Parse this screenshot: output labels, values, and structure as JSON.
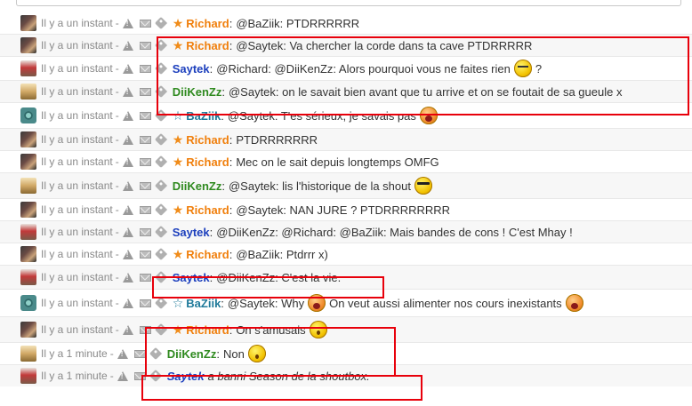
{
  "messages": [
    {
      "time": "Il y a un instant",
      "user": "Richard",
      "role": "orange",
      "avatar": "richard",
      "text": "@BaZiik: PTDRRRRRR"
    },
    {
      "time": "Il y a un instant",
      "user": "Richard",
      "role": "orange",
      "avatar": "richard",
      "text": "@Saytek: Va chercher la corde dans ta cave PTDRRRRR"
    },
    {
      "time": "Il y a un instant",
      "user": "Saytek",
      "role": "none",
      "avatar": "saytek",
      "text": "@Richard: @DiiKenZz: Alors pourquoi vous ne faites rien",
      "suffix": "?",
      "smiley": "sleepy"
    },
    {
      "time": "Il y a un instant",
      "user": "DiiKenZz",
      "role": "none",
      "avatar": "diikenzz",
      "text": "@Saytek: on le savait bien avant que tu arrive et on se foutait de sa gueule x"
    },
    {
      "time": "Il y a un instant",
      "user": "BaZiik",
      "role": "blue",
      "avatar": "baziik",
      "text": "@Saytek: T'es sérieux, je savais pas",
      "smiley": "shocked"
    },
    {
      "time": "Il y a un instant",
      "user": "Richard",
      "role": "orange",
      "avatar": "richard",
      "text": "PTDRRRRRRR"
    },
    {
      "time": "Il y a un instant",
      "user": "Richard",
      "role": "orange",
      "avatar": "richard",
      "text": "Mec on le sait depuis longtemps OMFG"
    },
    {
      "time": "Il y a un instant",
      "user": "DiiKenZz",
      "role": "none",
      "avatar": "diikenzz",
      "text": "@Saytek: lis l'historique de la shout",
      "smiley": "cool"
    },
    {
      "time": "Il y a un instant",
      "user": "Richard",
      "role": "orange",
      "avatar": "richard",
      "text": "@Saytek: NAN JURE ? PTDRRRRRRRR"
    },
    {
      "time": "Il y a un instant",
      "user": "Saytek",
      "role": "none",
      "avatar": "saytek",
      "text": "@DiiKenZz: @Richard: @BaZiik: Mais bandes de cons ! C'est Mhay !"
    },
    {
      "time": "Il y a un instant",
      "user": "Richard",
      "role": "orange",
      "avatar": "richard",
      "text": "@BaZiik: Ptdrrr x)"
    },
    {
      "time": "Il y a un instant",
      "user": "Saytek",
      "role": "none",
      "avatar": "saytek",
      "text": "@DiiKenZz: C'est la vie."
    },
    {
      "time": "Il y a un instant",
      "user": "BaZiik",
      "role": "blue",
      "avatar": "baziik",
      "text": "@Saytek: Why",
      "smiley": "shocked",
      "text2": "On veut aussi alimenter nos cours inexistants",
      "smiley2": "shocked"
    },
    {
      "time": "Il y a un instant",
      "user": "Richard",
      "role": "orange",
      "avatar": "richard",
      "text": "On s'amusais",
      "smiley": "oh"
    },
    {
      "time": "Il y a 1 minute",
      "user": "DiiKenZz",
      "role": "none",
      "avatar": "diikenzz",
      "text": "Non",
      "smiley": "oh"
    },
    {
      "time": "Il y a 1 minute",
      "user": "Saytek",
      "role": "none",
      "avatar": "saytek",
      "text": "a banni Season de la shoutbox.",
      "italic": true
    }
  ],
  "highlight_color": "#e8000b",
  "colors": {
    "richard": "#f07f0c",
    "saytek": "#1c3fbd",
    "diikenzz": "#2f8a1f",
    "baziik": "#1f7a9a"
  }
}
